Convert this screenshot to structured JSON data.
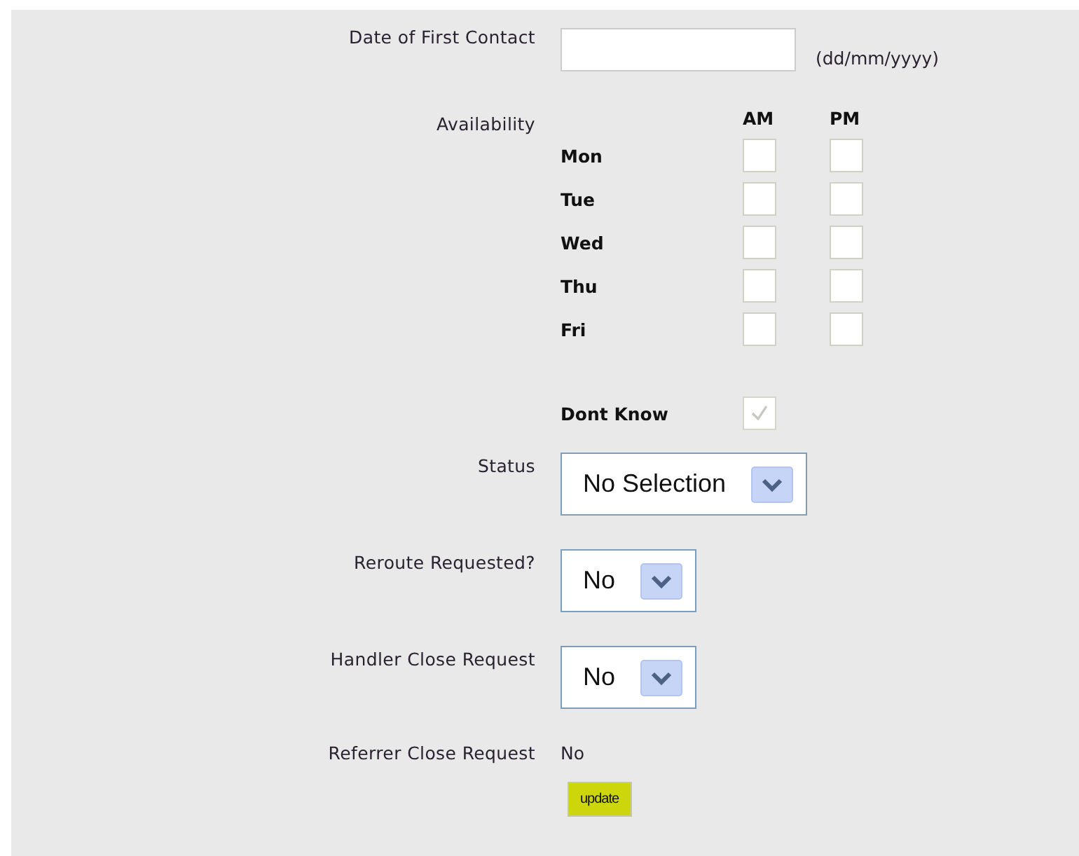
{
  "date_field": {
    "label": "Date of First Contact",
    "hint": "(dd/mm/yyyy)"
  },
  "availability": {
    "label": "Availability",
    "columns": [
      "AM",
      "PM"
    ],
    "days": [
      {
        "day": "Mon",
        "am": false,
        "pm": false
      },
      {
        "day": "Tue",
        "am": false,
        "pm": false
      },
      {
        "day": "Wed",
        "am": false,
        "pm": false
      },
      {
        "day": "Thu",
        "am": false,
        "pm": false
      },
      {
        "day": "Fri",
        "am": false,
        "pm": false
      }
    ],
    "dont_know": {
      "label": "Dont Know",
      "checked": true,
      "disabled": true
    }
  },
  "selects": [
    {
      "label": "Status",
      "value": "No Selection"
    },
    {
      "label": "Reroute Requested?",
      "value": "No"
    },
    {
      "label": "Handler Close Request",
      "value": "No"
    }
  ],
  "referrer": {
    "label": "Referrer Close Request",
    "value": "No"
  },
  "button": "update"
}
